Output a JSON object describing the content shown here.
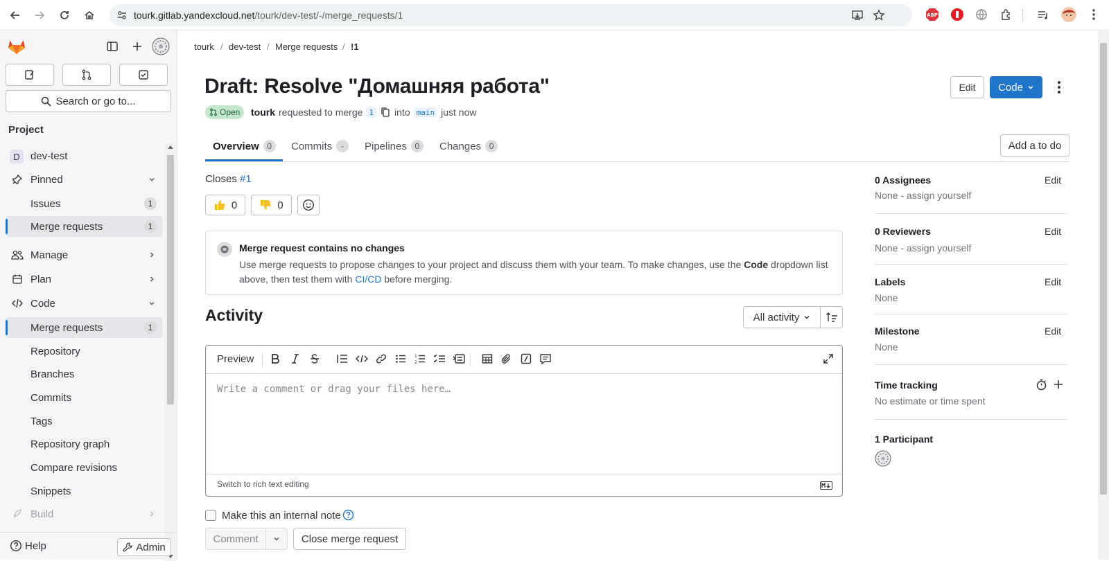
{
  "browser": {
    "url_host": "tourk.gitlab.yandexcloud.net",
    "url_path": "/tourk/dev-test/-/merge_requests/1"
  },
  "sidebar": {
    "search_label": "Search or go to...",
    "section_title": "Project",
    "project": {
      "initial": "D",
      "name": "dev-test"
    },
    "pinned": {
      "label": "Pinned",
      "items": [
        {
          "label": "Issues",
          "count": "1"
        },
        {
          "label": "Merge requests",
          "count": "1"
        }
      ]
    },
    "manage": "Manage",
    "plan": "Plan",
    "code": {
      "label": "Code",
      "items": [
        {
          "label": "Merge requests",
          "count": "1"
        },
        {
          "label": "Repository"
        },
        {
          "label": "Branches"
        },
        {
          "label": "Commits"
        },
        {
          "label": "Tags"
        },
        {
          "label": "Repository graph"
        },
        {
          "label": "Compare revisions"
        },
        {
          "label": "Snippets"
        }
      ]
    },
    "build": "Build",
    "help": "Help",
    "admin": "Admin"
  },
  "breadcrumb": [
    "tourk",
    "dev-test",
    "Merge requests",
    "!1"
  ],
  "mr": {
    "title": "Draft: Resolve \"Домашняя работа\"",
    "status": "Open",
    "author": "tourk",
    "requested_text": "requested to merge",
    "source_branch": "1",
    "into_text": "into",
    "target_branch": "main",
    "time": "just now"
  },
  "header_buttons": {
    "edit": "Edit",
    "code": "Code"
  },
  "tabs": [
    {
      "label": "Overview",
      "count": "0"
    },
    {
      "label": "Commits",
      "count": "-"
    },
    {
      "label": "Pipelines",
      "count": "0"
    },
    {
      "label": "Changes",
      "count": "0"
    }
  ],
  "todo_button": "Add a to do",
  "closes": {
    "label": "Closes",
    "issue": "#1"
  },
  "reactions": {
    "thumbs_up": "0",
    "thumbs_down": "0"
  },
  "notice": {
    "title": "Merge request contains no changes",
    "text_1": "Use merge requests to propose changes to your project and discuss them with your team. To make changes, use the",
    "code_word": "Code",
    "text_2": "dropdown list above, then test them with",
    "cicd": "CI/CD",
    "text_3": "before merging."
  },
  "activity": {
    "title": "Activity",
    "filter": "All activity"
  },
  "editor": {
    "preview": "Preview",
    "placeholder": "Write a comment or drag your files here…",
    "switch": "Switch to rich text editing"
  },
  "internal_note": "Make this an internal note",
  "comment_button": "Comment",
  "close_mr_button": "Close merge request",
  "right_sidebar": {
    "assignees": {
      "title": "0 Assignees",
      "value": "None - assign yourself",
      "edit": "Edit"
    },
    "reviewers": {
      "title": "0 Reviewers",
      "value": "None - assign yourself",
      "edit": "Edit"
    },
    "labels": {
      "title": "Labels",
      "value": "None",
      "edit": "Edit"
    },
    "milestone": {
      "title": "Milestone",
      "value": "None",
      "edit": "Edit"
    },
    "time_tracking": {
      "title": "Time tracking",
      "value": "No estimate or time spent"
    },
    "participants": {
      "title": "1 Participant"
    }
  },
  "colors": {
    "accent": "#1f75cb",
    "open_badge_bg": "#c3e6cd",
    "open_badge_fg": "#24663b"
  }
}
